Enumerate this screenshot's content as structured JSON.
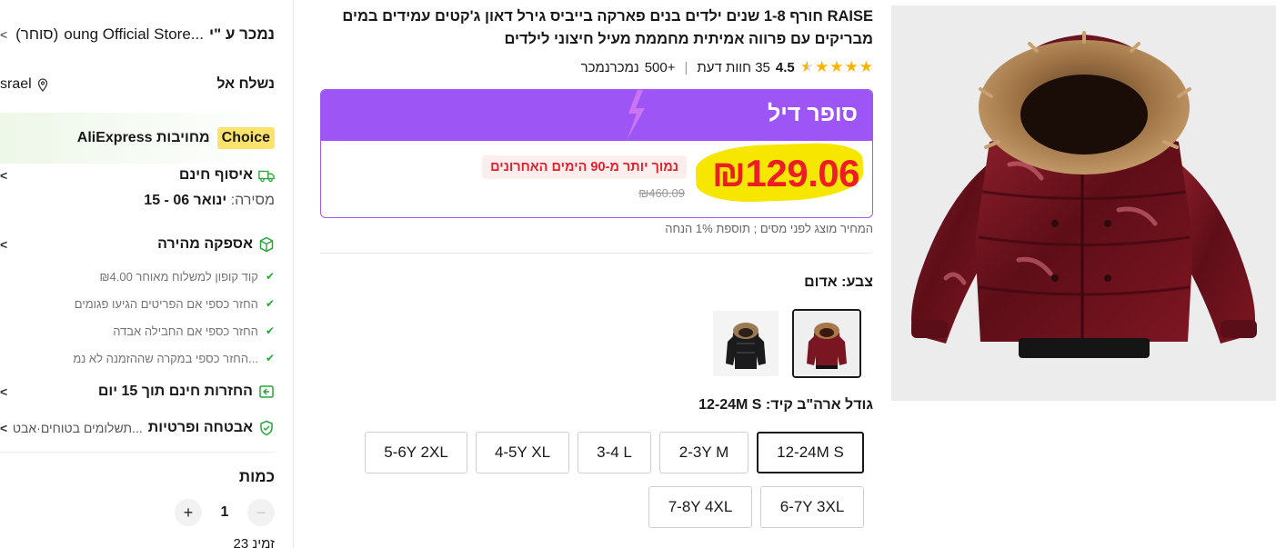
{
  "sidebar": {
    "seller": {
      "label": "נמכר ע \"י",
      "store": "oung Official Store...",
      "link": "(סוחר)"
    },
    "ship": {
      "label": "נשלח אל",
      "country": "srael"
    },
    "choice": {
      "badge": "Choice",
      "text": "AliExpress מחויבות"
    },
    "free_pickup": {
      "title": "איסוף חינם",
      "delivery_label": "מסירה:",
      "delivery_dates": "ינואר 06 - 15"
    },
    "fast_delivery": {
      "title": "אספקה מהירה",
      "features": [
        "₪4.00 קוד קופון למשלוח מאוחר",
        "החזר כספי אם הפריטים הגיעו פגומים",
        "החזר כספי אם החבילה אבדה",
        "החזר כספי במקרה שההזמנה לא נמ..."
      ]
    },
    "free_returns": {
      "title": "החזרות חינם תוך 15 יום"
    },
    "security": {
      "title": "אבטחה ופרטיות",
      "subtitle": "תשלומים בטוחים·אבט..."
    },
    "quantity": {
      "label": "כמות",
      "value": "1",
      "minus": "−",
      "plus": "+",
      "available": "23 זמינ"
    }
  },
  "product": {
    "title": "RAISE חורף 1-8 שנים ילדים בנים פארקה בייביס גירל דאון ג'קטים עמידים במים מבריקים עם פרווה אמיתית מחממת מעיל חיצוני לילדים",
    "rating": {
      "value": "4.5",
      "stars": 4.5,
      "reviews_count": "35",
      "reviews_label": "חוות דעת",
      "sold_count": "500+",
      "sold_label": "נמכרנמכר"
    }
  },
  "deal": {
    "title": "סופר דיל",
    "price": "₪129.06",
    "old_price": "₪460.09",
    "lowest_badge": "נמוך יותר מ-90 הימים האחרונים",
    "tax_note": "המחיר מוצג לפני מסים ; תוספת 1% הנחה",
    "colors": {
      "deal_purple": "#9d55f6",
      "price_red": "#ee1d23"
    }
  },
  "color": {
    "label": "צבע: אדום",
    "swatches": [
      "red-jacket",
      "black-jacket"
    ]
  },
  "size": {
    "label": "גודל ארה\"ב קיד: 12-24M S",
    "options": [
      "12-24M S",
      "2-3Y M",
      "3-4 L",
      "4-5Y XL",
      "5-6Y 2XL",
      "6-7Y 3XL",
      "7-8Y 4XL"
    ]
  }
}
